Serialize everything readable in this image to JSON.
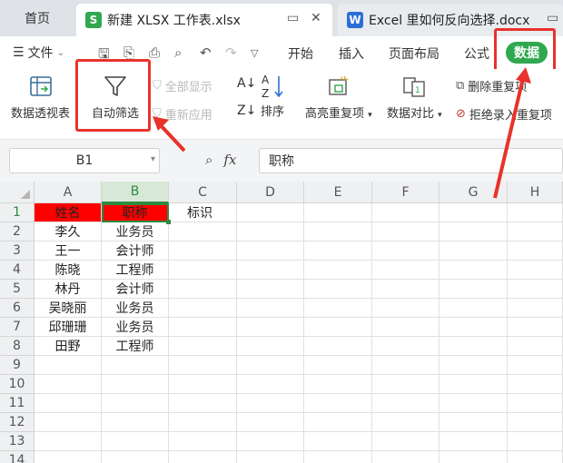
{
  "tabs": {
    "home": "首页",
    "active": {
      "title": "新建 XLSX 工作表.xlsx",
      "badge": "S",
      "color": "#2fa84f"
    },
    "second": {
      "title": "Excel 里如何反向选择.docx",
      "badge": "W",
      "color": "#2b6fd6"
    }
  },
  "menu": {
    "file": "文件",
    "items": [
      "开始",
      "插入",
      "页面布局",
      "公式"
    ],
    "data_tab": "数据"
  },
  "ribbon": {
    "pivot": "数据透视表",
    "autofilter": "自动筛选",
    "show_all": "全部显示",
    "reapply": "重新应用",
    "sort": "排序",
    "highlight_dup": "高亮重复项",
    "data_compare": "数据对比",
    "remove_dup": "删除重复项",
    "reject_dup": "拒绝录入重复项"
  },
  "formula_bar": {
    "name_box": "B1",
    "fx": "fx",
    "value": "职称"
  },
  "sheet": {
    "columns": [
      "A",
      "B",
      "C",
      "D",
      "E",
      "F",
      "G",
      "H"
    ],
    "rows": [
      "1",
      "2",
      "3",
      "4",
      "5",
      "6",
      "7",
      "8",
      "9",
      "10",
      "11",
      "12",
      "13",
      "14"
    ],
    "header": {
      "a": "姓名",
      "b": "职称",
      "c": "标识"
    },
    "data": [
      {
        "a": "李久",
        "b": "业务员"
      },
      {
        "a": "王一",
        "b": "会计师"
      },
      {
        "a": "陈晓",
        "b": "工程师"
      },
      {
        "a": "林丹",
        "b": "会计师"
      },
      {
        "a": "吴晓丽",
        "b": "业务员"
      },
      {
        "a": "邱珊珊",
        "b": "业务员"
      },
      {
        "a": "田野",
        "b": "工程师"
      }
    ]
  },
  "colors": {
    "accent": "#2fa84f",
    "annotation": "#e8322a",
    "header_fill": "#ff0000"
  }
}
